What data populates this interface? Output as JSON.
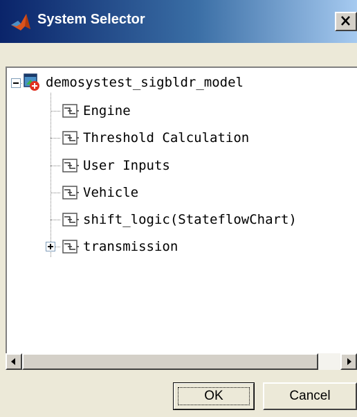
{
  "window": {
    "title": "System Selector",
    "close_glyph": "X"
  },
  "tree": {
    "root": {
      "label": "demosystest_sigbldr_model",
      "icon": "model-icon",
      "expanded": true
    },
    "children": [
      {
        "label": "Engine",
        "icon": "subsystem-block-icon"
      },
      {
        "label": "Threshold Calculation",
        "icon": "subsystem-block-icon"
      },
      {
        "label": "User Inputs",
        "icon": "subsystem-block-icon"
      },
      {
        "label": "Vehicle",
        "icon": "subsystem-block-icon"
      },
      {
        "label": "shift_logic(StateflowChart)",
        "icon": "subsystem-block-icon"
      },
      {
        "label": "transmission",
        "icon": "subsystem-block-icon",
        "expandable": true,
        "expanded": false
      }
    ]
  },
  "buttons": {
    "ok_label": "OK",
    "cancel_label": "Cancel"
  },
  "colors": {
    "titlebar_start": "#0a246a",
    "titlebar_end": "#a6caf0",
    "dialog_bg": "#ece9d8"
  }
}
